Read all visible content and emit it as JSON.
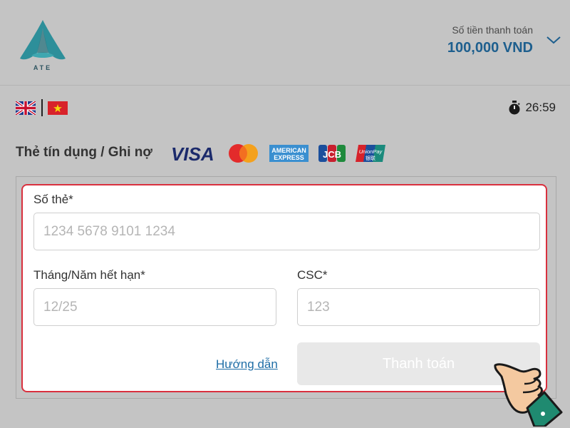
{
  "header": {
    "logo_text": "ATE",
    "amount_label": "Số tiền thanh toán",
    "amount_value": "100,000 VND",
    "expand_icon": "chevron-down-icon"
  },
  "language_bar": {
    "flags": [
      "flag-uk-icon",
      "flag-vietnam-icon"
    ],
    "timer_icon": "stopwatch-icon",
    "timer_value": "26:59"
  },
  "payment_method": {
    "title": "Thẻ tín dụng / Ghi nợ",
    "brands": [
      "VISA",
      "Mastercard",
      "American Express",
      "JCB",
      "UnionPay"
    ],
    "brand_texts": {
      "visa": "VISA",
      "amex_top": "AMERICAN",
      "amex_bottom": "EXPRESS",
      "jcb": "JCB",
      "unionpay_top": "UnionPay",
      "unionpay_bottom": "银联"
    }
  },
  "form": {
    "card_number": {
      "label": "Số thẻ*",
      "placeholder": "1234 5678 9101 1234",
      "value": ""
    },
    "expiry": {
      "label": "Tháng/Năm hết hạn*",
      "placeholder": "12/25",
      "value": ""
    },
    "csc": {
      "label": "CSC*",
      "placeholder": "123",
      "value": ""
    },
    "guide_link": "Hướng dẫn",
    "submit_label": "Thanh toán",
    "submit_enabled": false
  },
  "colors": {
    "accent": "#1e5f8e",
    "highlight_border": "#d9303e",
    "link": "#1e6da6",
    "button_disabled": "#e8e8e8",
    "overlay_background": "#c4c4c4"
  }
}
